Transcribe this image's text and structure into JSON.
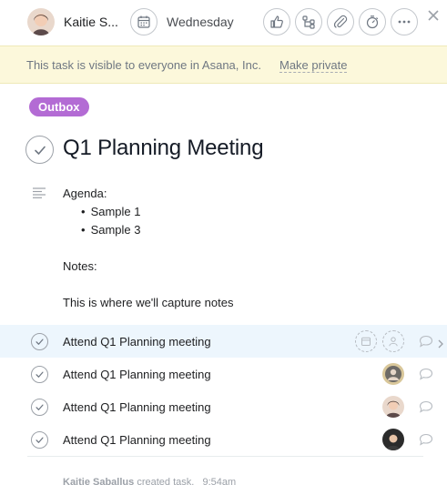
{
  "header": {
    "assignee_name": "Kaitie S...",
    "due_label": "Wednesday",
    "icons": [
      "like-icon",
      "subtask-icon",
      "attachment-icon",
      "timer-icon",
      "more-icon",
      "close-icon"
    ]
  },
  "banner": {
    "text": "This task is visible to everyone in Asana, Inc.",
    "action": "Make private"
  },
  "tag": {
    "label": "Outbox",
    "color": "#b36bd4"
  },
  "task": {
    "title": "Q1 Planning Meeting",
    "description": {
      "agenda_label": "Agenda:",
      "agenda_items": [
        "Sample 1",
        "Sample 3"
      ],
      "notes_label": "Notes:",
      "notes_text": "This is where we'll capture notes"
    }
  },
  "subtasks": [
    {
      "name": "Attend Q1 Planning meeting",
      "assignee": "unassigned"
    },
    {
      "name": "Attend Q1 Planning meeting",
      "assignee": "user-avatar"
    },
    {
      "name": "Attend Q1 Planning meeting",
      "assignee": "user-avatar"
    },
    {
      "name": "Attend Q1 Planning meeting",
      "assignee": "user-avatar"
    }
  ],
  "story": {
    "author": "Kaitie Saballus",
    "action": "created task.",
    "time": "9:54am"
  },
  "colors": {
    "banner_bg": "#fcf8db",
    "hover_row_bg": "#edf6fd",
    "tag_bg": "#b36bd4"
  }
}
